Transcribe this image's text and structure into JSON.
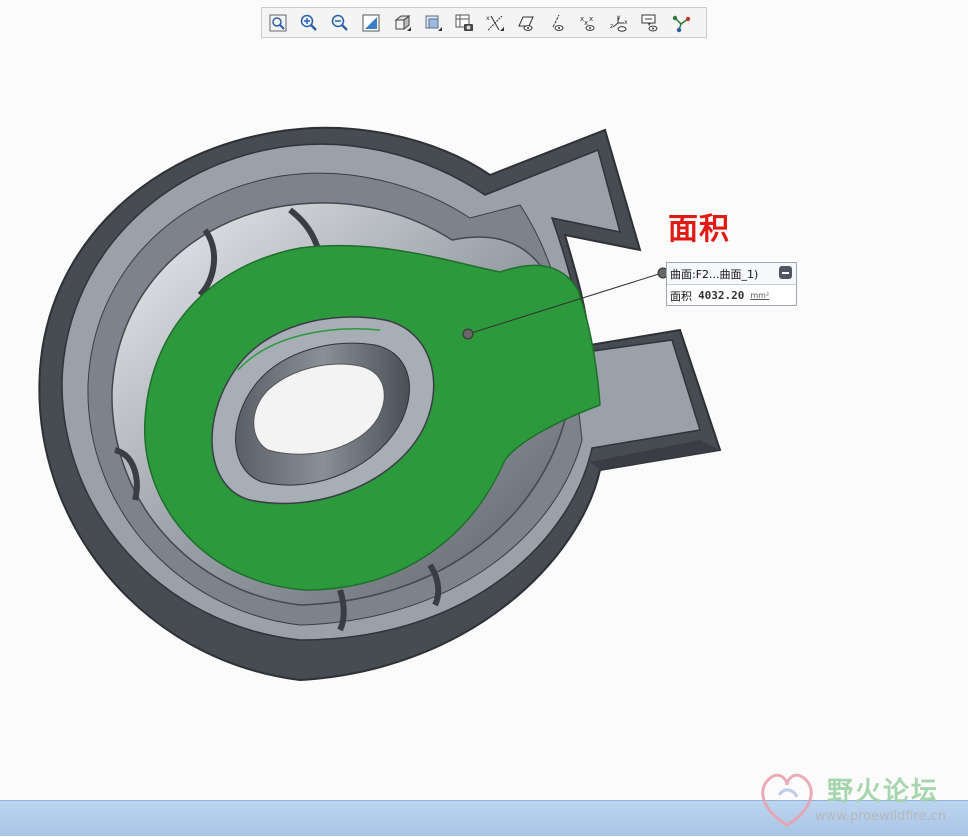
{
  "toolbar": {
    "buttons": [
      {
        "name": "refit-icon"
      },
      {
        "name": "zoom-in-icon"
      },
      {
        "name": "zoom-out-icon"
      },
      {
        "name": "repaint-icon"
      },
      {
        "name": "view-orientation-icon"
      },
      {
        "name": "display-style-icon"
      },
      {
        "name": "saved-views-icon"
      },
      {
        "name": "datum-display-icon"
      },
      {
        "name": "plane-display-icon"
      },
      {
        "name": "axis-display-icon"
      },
      {
        "name": "point-display-icon"
      },
      {
        "name": "csys-display-icon"
      },
      {
        "name": "annotation-display-icon"
      },
      {
        "name": "spin-center-icon"
      }
    ]
  },
  "annotation": {
    "title": "面积"
  },
  "callout": {
    "reference": "曲面:F2...曲面_1)",
    "label": "面积",
    "value": "4032.20",
    "unit": "mm²"
  },
  "watermark": {
    "name": "野火论坛",
    "url": "www.proewildfire.cn"
  },
  "colors": {
    "highlight_surface": "#2c9a3c",
    "part_dark": "#4a4e55",
    "part_light": "#a8aeb6",
    "annotation_red": "#e01b16",
    "statusbar": "#b4cdec"
  }
}
